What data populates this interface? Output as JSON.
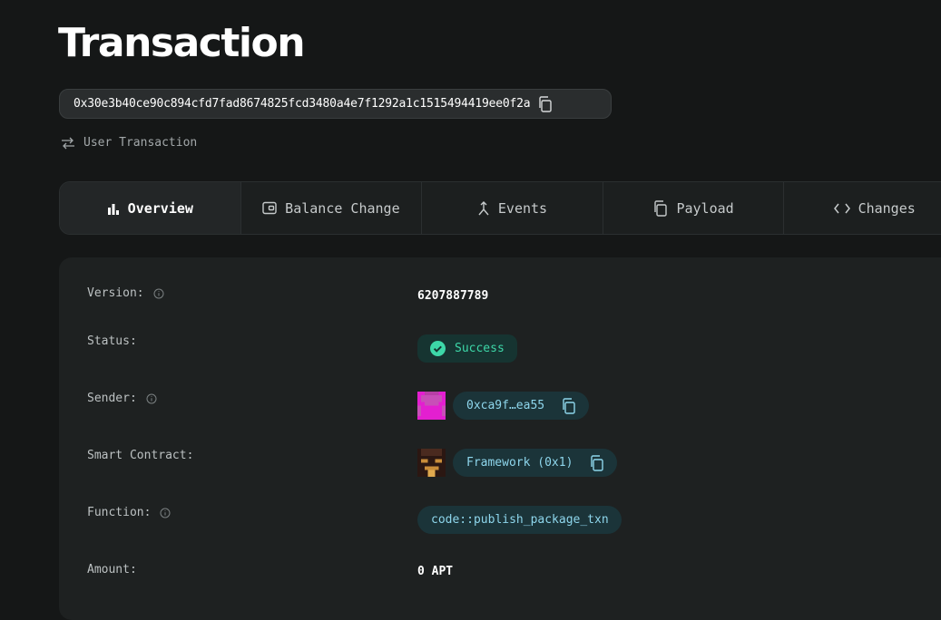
{
  "page": {
    "title": "Transaction"
  },
  "transaction": {
    "hash": "0x30e3b40ce90c894cfd7fad8674825fcd3480a4e7f1292a1c1515494419ee0f2a",
    "type": "User Transaction"
  },
  "tabs": [
    {
      "label": "Overview",
      "icon": "bar-chart-icon",
      "active": true
    },
    {
      "label": "Balance Change",
      "icon": "wallet-icon",
      "active": false
    },
    {
      "label": "Events",
      "icon": "events-icon",
      "active": false
    },
    {
      "label": "Payload",
      "icon": "copy-icon",
      "active": false
    },
    {
      "label": "Changes",
      "icon": "code-icon",
      "active": false
    }
  ],
  "details": {
    "version": {
      "label": "Version:",
      "value": "6207887789"
    },
    "status": {
      "label": "Status:",
      "value": "Success"
    },
    "sender": {
      "label": "Sender:",
      "value": "0xca9f…ea55"
    },
    "smart_contract": {
      "label": "Smart Contract:",
      "value": "Framework (0x1)"
    },
    "function": {
      "label": "Function:",
      "value": "code::publish_package_txn"
    },
    "amount": {
      "label": "Amount:",
      "value": "0 APT"
    }
  },
  "colors": {
    "background": "#151717",
    "success": "#3dd7a8",
    "address_accent": "#8ed6ec",
    "sender_avatar": "#e31fd0"
  }
}
